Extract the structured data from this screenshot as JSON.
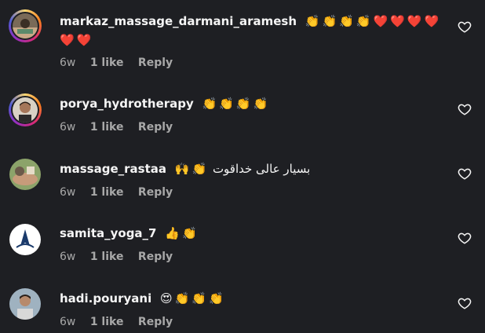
{
  "comments": [
    {
      "username": "markaz_massage_darmani_aramesh",
      "text": "",
      "emojis": "👏👏👏👏❤️❤️❤️❤️ ❤️❤️",
      "time": "6w",
      "likes": "1 like",
      "reply": "Reply",
      "avatar_icon": "spa-photo-avatar",
      "avatar_ring": true
    },
    {
      "username": "porya_hydrotherapy",
      "text": "",
      "emojis": "👏👏👏👏",
      "time": "6w",
      "likes": "1 like",
      "reply": "Reply",
      "avatar_icon": "man-photo-avatar",
      "avatar_ring": true
    },
    {
      "username": "massage_rastaa",
      "text": "بسیار عالی خداقوت",
      "emojis": "🙌👏",
      "time": "6w",
      "likes": "1 like",
      "reply": "Reply",
      "avatar_icon": "massage-photo-avatar",
      "avatar_ring": false
    },
    {
      "username": "samita_yoga_7",
      "text": "",
      "emojis": "👍👏",
      "time": "6w",
      "likes": "1 like",
      "reply": "Reply",
      "avatar_icon": "yoga-logo-avatar",
      "avatar_ring": false
    },
    {
      "username": "hadi.pouryani",
      "text": "",
      "emojis": "😍👏👏👏",
      "time": "6w",
      "likes": "1 like",
      "reply": "Reply",
      "avatar_icon": "man-photo-avatar",
      "avatar_ring": false
    }
  ],
  "colors": {
    "background": "#1e1f23",
    "text": "#f5f5f5",
    "meta": "#a8a8a8"
  }
}
